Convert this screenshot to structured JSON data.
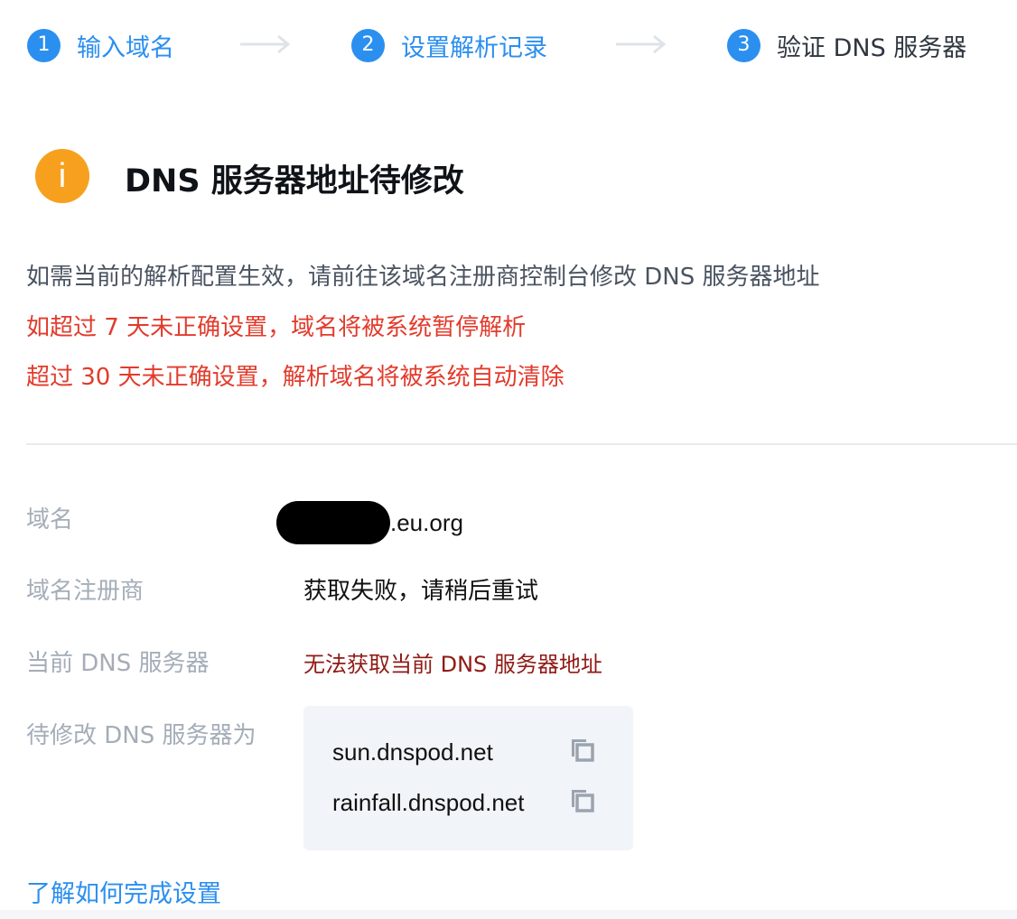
{
  "steps": [
    {
      "number": "1",
      "label": "输入域名"
    },
    {
      "number": "2",
      "label": "设置解析记录"
    },
    {
      "number": "3",
      "label": "验证 DNS 服务器"
    }
  ],
  "status": {
    "icon": "info-icon",
    "icon_glyph": "i",
    "icon_color": "#f7a01e",
    "title": "DNS 服务器地址待修改"
  },
  "description": {
    "main": "如需当前的解析配置生效，请前往该域名注册商控制台修改 DNS 服务器地址",
    "warning_1": "如超过 7 天未正确设置，域名将被系统暂停解析",
    "warning_2": "超过 30 天未正确设置，解析域名将被系统自动清除"
  },
  "fields": {
    "domain_label": "域名",
    "domain_suffix": ".eu.org",
    "registrar_label": "域名注册商",
    "registrar_value": "获取失败，请稍后重试",
    "current_dns_label": "当前 DNS 服务器",
    "current_dns_value": "无法获取当前 DNS 服务器地址",
    "target_dns_label": "待修改 DNS 服务器为"
  },
  "nameservers": [
    "sun.dnspod.net",
    "rainfall.dnspod.net"
  ],
  "help_link": "了解如何完成设置",
  "colors": {
    "accent": "#2b8ff0",
    "warning": "#e23b2c",
    "error_text": "#8f1a14"
  }
}
